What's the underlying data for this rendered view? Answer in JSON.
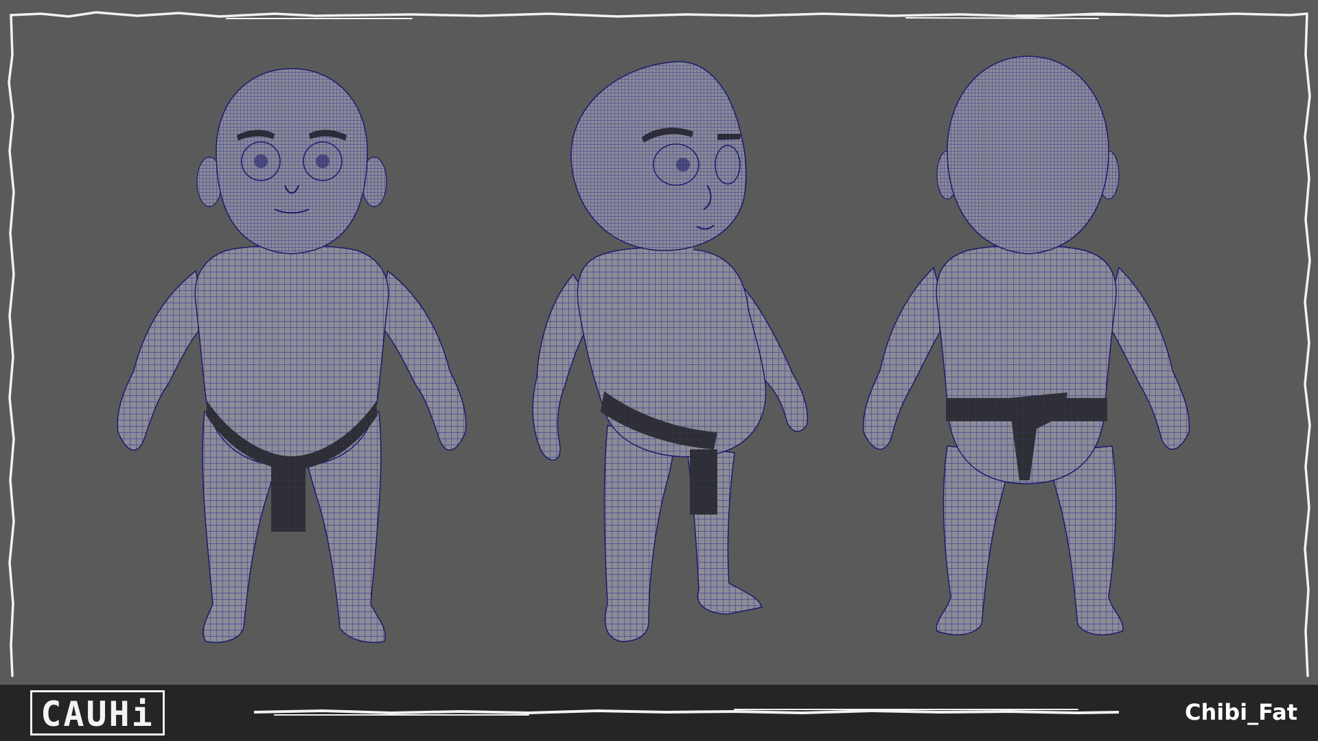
{
  "viewport": {
    "background_color": "#5a5a5a",
    "frame_stroke_color": "#f2f2f2",
    "views": [
      {
        "view": "front",
        "icon": "character-front-view-icon"
      },
      {
        "view": "three-quarter",
        "icon": "character-three-quarter-view-icon"
      },
      {
        "view": "back",
        "icon": "character-back-view-icon"
      }
    ],
    "mesh_colors": {
      "skin": "#8c8c96",
      "wire": "#1a1a8c",
      "belt": "#2e2e36"
    }
  },
  "footer": {
    "background_color": "#252525",
    "logo_text": "CAUHi",
    "title": "Chibi_Fat"
  }
}
